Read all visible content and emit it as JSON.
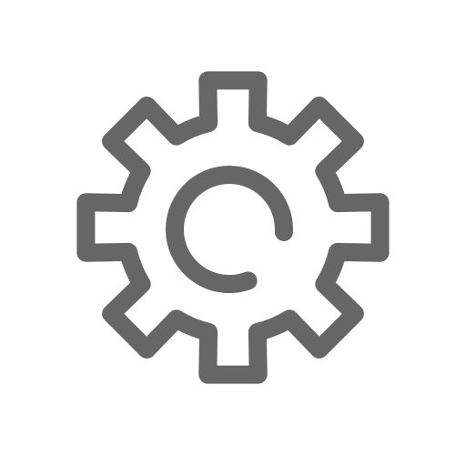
{
  "icon": {
    "name": "gear-icon",
    "stroke_color": "#666666",
    "background_color": "#ffffff"
  }
}
